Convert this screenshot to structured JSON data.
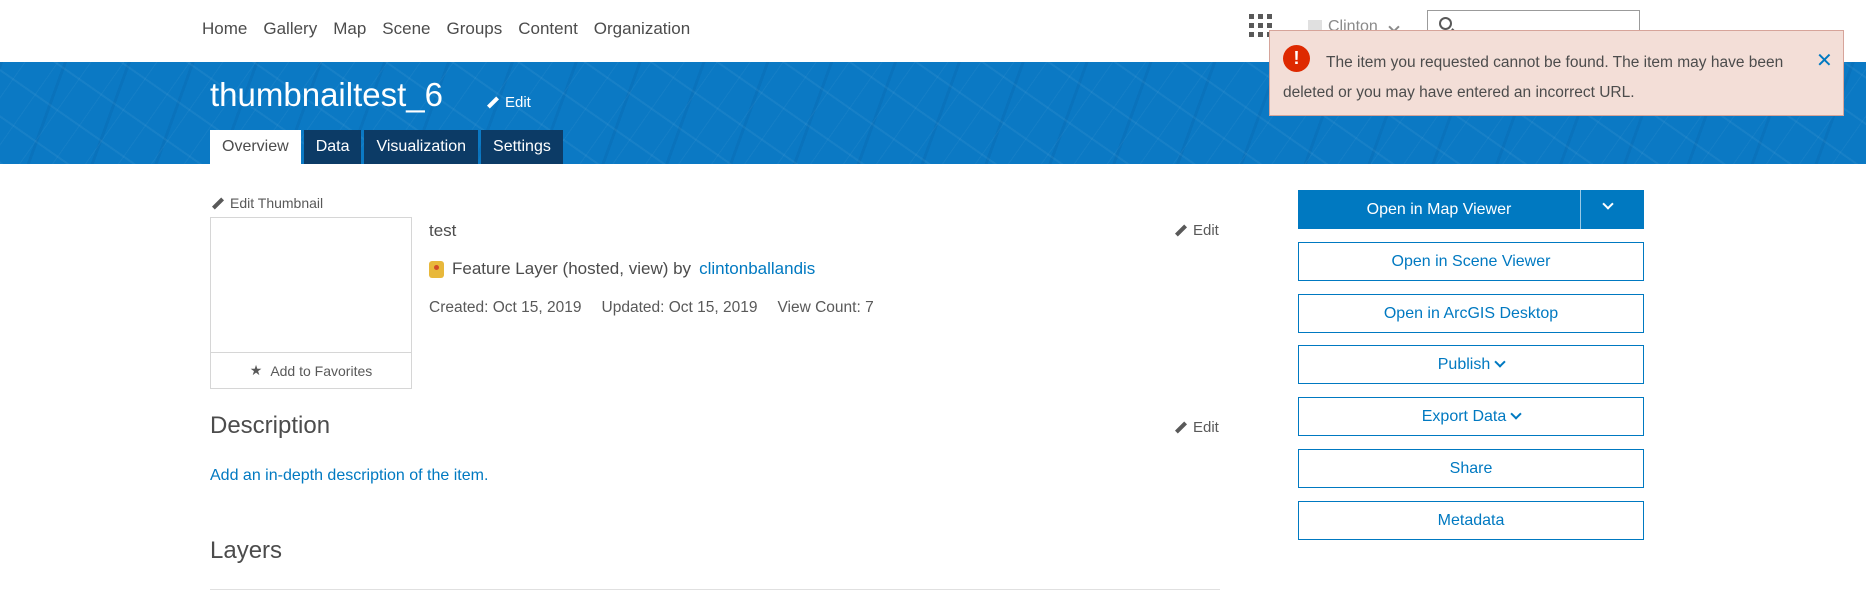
{
  "nav": {
    "links": [
      "Home",
      "Gallery",
      "Map",
      "Scene",
      "Groups",
      "Content",
      "Organization"
    ],
    "user_name": "Clinton"
  },
  "item": {
    "title": "thumbnailtest_6",
    "title_edit": "Edit",
    "tabs": [
      "Overview",
      "Data",
      "Visualization",
      "Settings"
    ],
    "active_tab": "Overview"
  },
  "toast": {
    "message": "The item you requested cannot be found. The item may have been deleted or you may have entered an incorrect URL.",
    "close_icon": "close-icon",
    "color": "#de2900"
  },
  "overview": {
    "edit_thumbnail": "Edit Thumbnail",
    "add_favorites": "Add to Favorites",
    "summary": "test",
    "summary_edit": "Edit",
    "type_text": "Feature Layer (hosted, view) by",
    "owner": "clintonballandis",
    "created": "Created: Oct 15, 2019",
    "updated": "Updated: Oct 15, 2019",
    "view_count": "View Count: 7",
    "description_heading": "Description",
    "description_edit": "Edit",
    "description_link": "Add an in-depth description of the item.",
    "layers_heading": "Layers"
  },
  "actions": {
    "open_map_viewer": "Open in Map Viewer",
    "open_scene_viewer": "Open in Scene Viewer",
    "open_desktop": "Open in ArcGIS Desktop",
    "publish": "Publish",
    "export_data": "Export Data",
    "share": "Share",
    "metadata": "Metadata"
  },
  "colors": {
    "brand_blue": "#0079c1",
    "banner_blue": "#0b79c4",
    "tab_dark": "#0c3b66",
    "toast_bg": "#f3ded7"
  }
}
